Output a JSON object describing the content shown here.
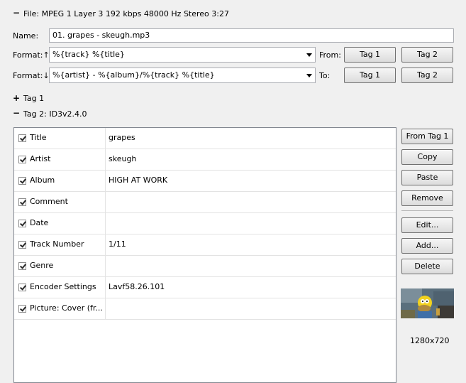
{
  "file_info": "File: MPEG 1 Layer 3 192 kbps 48000 Hz Stereo 3:27",
  "name": {
    "label": "Name:",
    "value": "01. grapes - skeugh.mp3"
  },
  "format_up": {
    "label": "Format:↑",
    "value": "%{track} %{title}",
    "side_label": "From:",
    "tag1": "Tag 1",
    "tag2": "Tag 2"
  },
  "format_down": {
    "label": "Format:↓",
    "value": "%{artist} - %{album}/%{track} %{title}",
    "side_label": "To:",
    "tag1": "Tag 1",
    "tag2": "Tag 2"
  },
  "tag1_section": {
    "expander": "+",
    "label": "Tag 1"
  },
  "tag2_section": {
    "expander": "−",
    "label": "Tag 2: ID3v2.4.0"
  },
  "file_expander": "−",
  "frames": [
    {
      "name": "Title",
      "value": "grapes",
      "checked": true
    },
    {
      "name": "Artist",
      "value": "skeugh",
      "checked": true
    },
    {
      "name": "Album",
      "value": "HIGH AT WORK",
      "checked": true
    },
    {
      "name": "Comment",
      "value": "",
      "checked": true
    },
    {
      "name": "Date",
      "value": "",
      "checked": true
    },
    {
      "name": "Track Number",
      "value": "1/11",
      "checked": true
    },
    {
      "name": "Genre",
      "value": "",
      "checked": true
    },
    {
      "name": "Encoder Settings",
      "value": "Lavf58.26.101",
      "checked": true
    },
    {
      "name": "Picture: Cover (fr...",
      "value": "",
      "checked": true
    }
  ],
  "buttons": {
    "from_tag1": "From Tag 1",
    "copy": "Copy",
    "paste": "Paste",
    "remove": "Remove",
    "edit": "Edit...",
    "add": "Add...",
    "delete": "Delete"
  },
  "picture_size": "1280x720"
}
